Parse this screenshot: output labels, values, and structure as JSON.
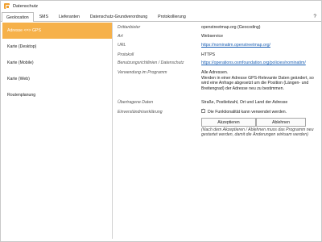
{
  "window": {
    "title": "Datenschutz"
  },
  "tabs": [
    "Geolocation",
    "SMS",
    "Lieferanten",
    "Datenschutz-Grundverordnung",
    "Protokollierung"
  ],
  "active_tab_index": 0,
  "help_label": "?",
  "sidebar": {
    "active_index": 0,
    "items": [
      {
        "label": "Adresse <=> GPS"
      },
      {
        "label": "Karte (Desktop)"
      },
      {
        "label": "Karte (Mobile)"
      },
      {
        "label": "Karte (Web)"
      },
      {
        "label": "Routenplanung"
      }
    ]
  },
  "details": {
    "drittanbieter": {
      "label": "Drittanbieter",
      "value": "openstreetmap.org (Geocoding)"
    },
    "art": {
      "label": "Art",
      "value": "Webservice"
    },
    "url": {
      "label": "URL",
      "value": "https://nominatim.openstreetmap.org/"
    },
    "protokoll": {
      "label": "Protokoll",
      "value": "HTTPS"
    },
    "richtlinien": {
      "label": "Benutzungsrichtlinien / Datenschutz",
      "value": "https://operations.osmfoundation.org/policies/nominatim/"
    },
    "verwendung": {
      "label": "Verwendung im Programm",
      "line1": "Alle Adressen.",
      "line2": "Werden in einer Adresse GPS-Relevante Daten geändert, so wird eine Anfrage abgesetzt um die Position (Längen- und Breitengrad) der Adresse neu zu bestimmen."
    },
    "daten": {
      "label": "Übertragene Daten",
      "value": "Straße, Postleitzahl, Ort und Land der Adresse"
    },
    "einverstaendnis": {
      "label": "Einverständniserklärung",
      "check_text": "Die Funktionalität kann verwendet werden.",
      "checked": true,
      "accept_label": "Akzeptieren",
      "decline_label": "Ablehnen",
      "note": "(Nach dem Akzeptieren / Ablehnen muss das Programm neu gestartet werden, damit die Änderungen wirksam werden)"
    }
  },
  "colors": {
    "accent": "#f6b14a",
    "link": "#1a5fb4"
  }
}
